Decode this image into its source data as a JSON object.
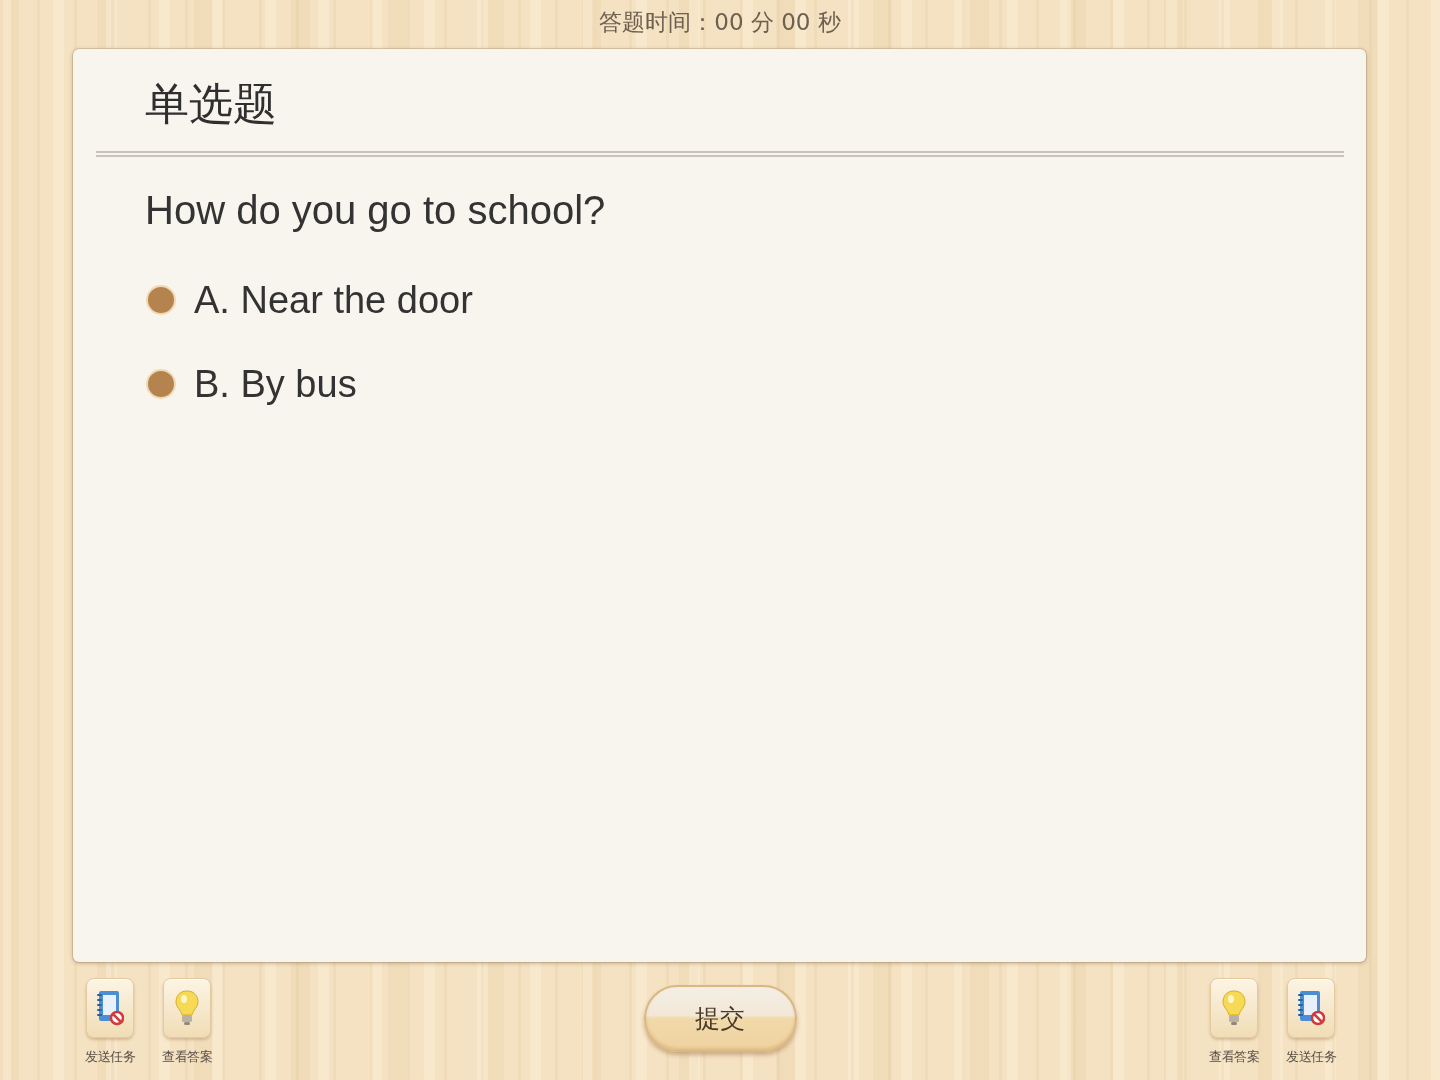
{
  "timer": {
    "text": "答题时间：00 分 00 秒"
  },
  "question": {
    "type_label": "单选题",
    "text": "How do you go to school?",
    "options": [
      {
        "label": "A. Near the door",
        "selected": false
      },
      {
        "label": "B. By bus",
        "selected": false
      }
    ]
  },
  "toolbar": {
    "left": [
      {
        "kind": "send",
        "label": "发送任务"
      },
      {
        "kind": "answer",
        "label": "查看答案"
      }
    ],
    "submit": "提交",
    "right": [
      {
        "kind": "answer",
        "label": "查看答案"
      },
      {
        "kind": "send",
        "label": "发送任务"
      }
    ]
  }
}
